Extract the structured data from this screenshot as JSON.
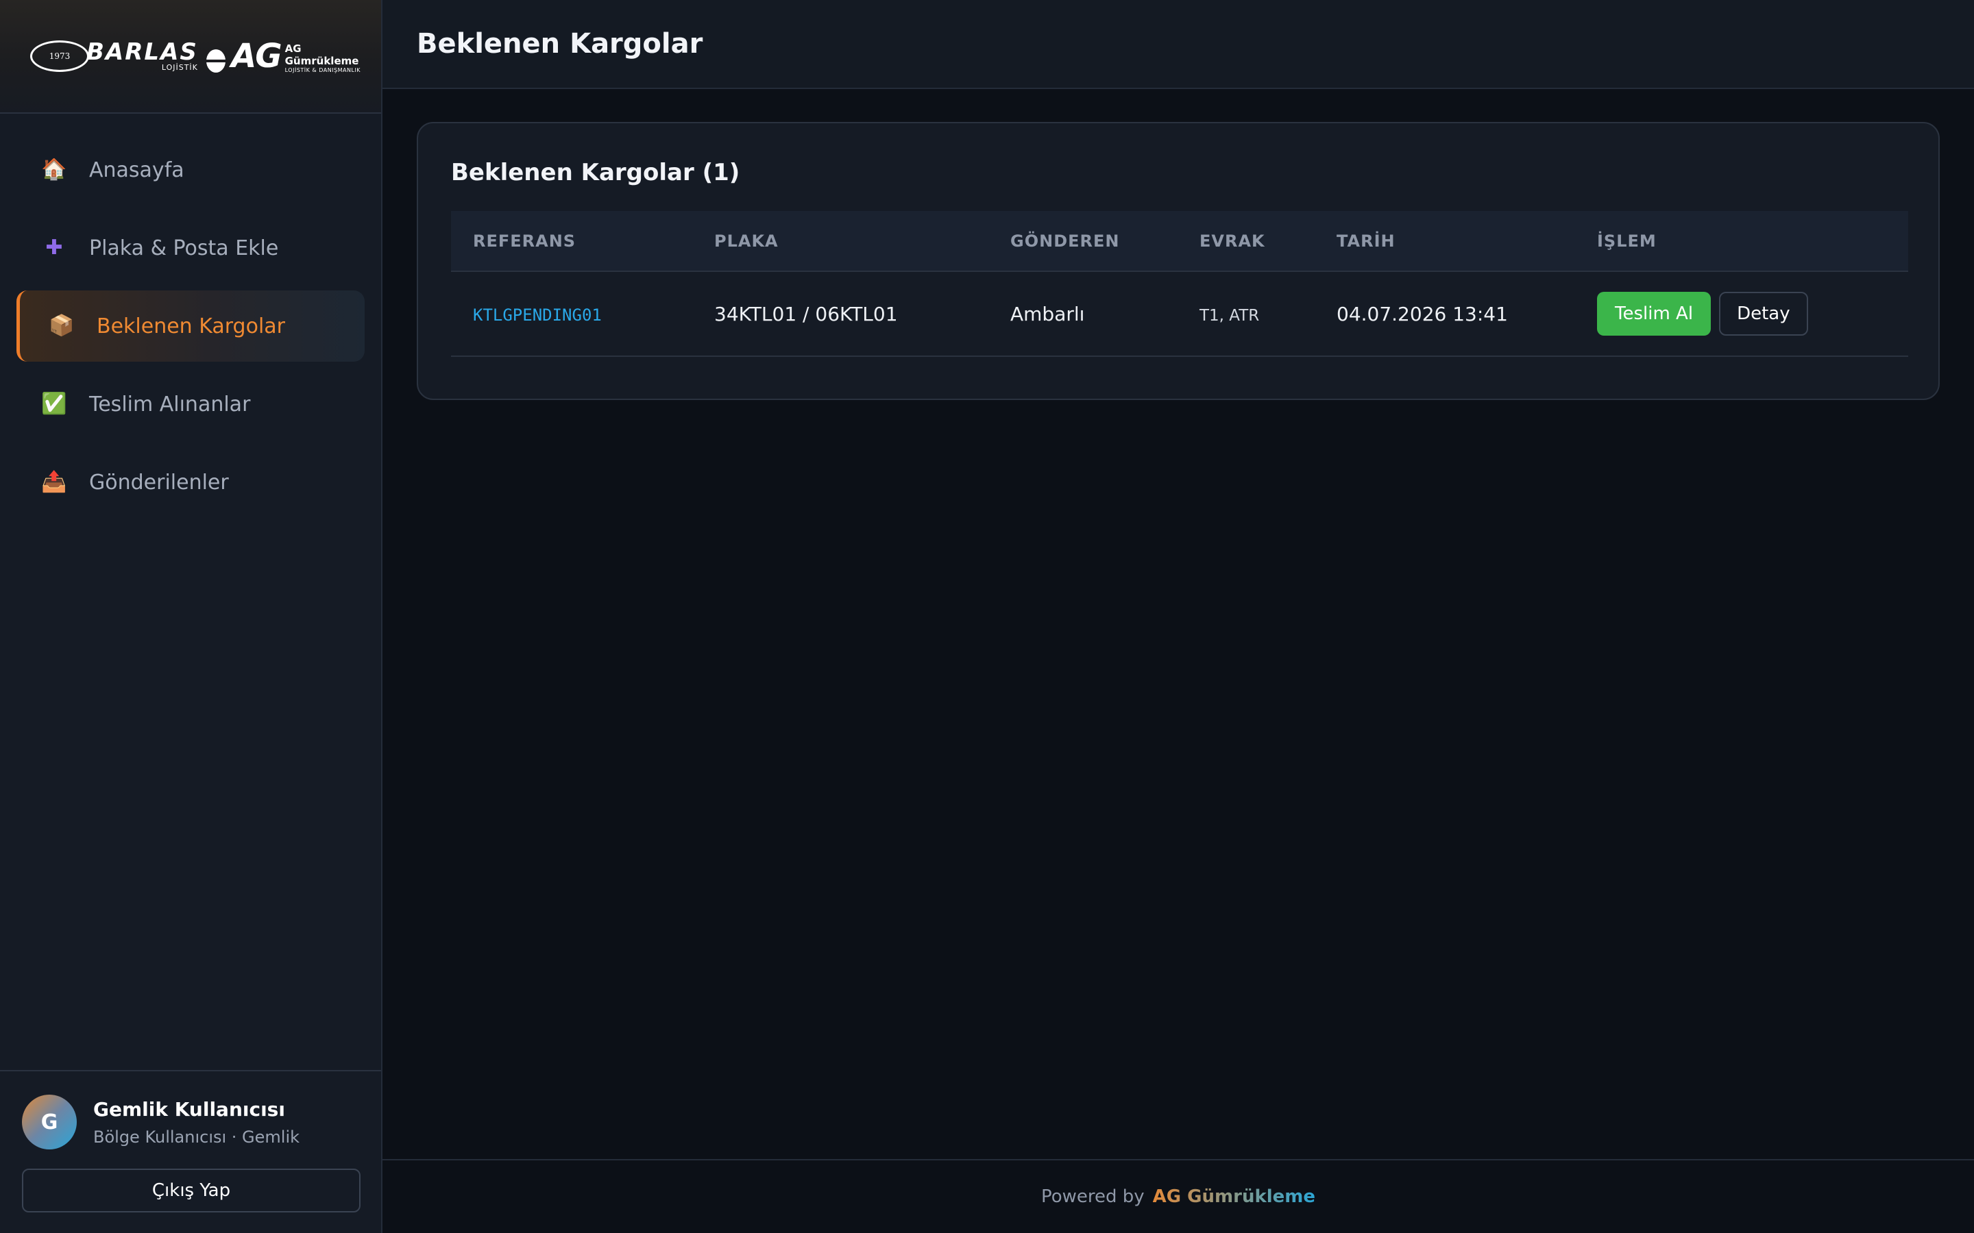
{
  "brand": {
    "logo_year": "1973",
    "logo_name": "BARLAS",
    "logo_sub": "LOJİSTİK",
    "logo_ag": "AG",
    "logo_ag_title": "AG Gümrükleme",
    "logo_ag_sub": "LOJİSTİK & DANIŞMANLIK"
  },
  "sidebar": {
    "items": [
      {
        "label": "Anasayfa",
        "icon": "house-icon",
        "glyph": "🏠",
        "active": false
      },
      {
        "label": "Plaka & Posta Ekle",
        "icon": "plus-icon",
        "glyph": "✚",
        "active": false
      },
      {
        "label": "Beklenen Kargolar",
        "icon": "package-icon",
        "glyph": "📦",
        "active": true
      },
      {
        "label": "Teslim Alınanlar",
        "icon": "check-box-icon",
        "glyph": "✅",
        "active": false
      },
      {
        "label": "Gönderilenler",
        "icon": "outbox-icon",
        "glyph": "📤",
        "active": false
      }
    ]
  },
  "user": {
    "initial": "G",
    "name": "Gemlik Kullanıcısı",
    "role": "Bölge Kullanıcısı · Gemlik",
    "logout_label": "Çıkış Yap"
  },
  "header": {
    "title": "Beklenen Kargolar"
  },
  "card": {
    "title": "Beklenen Kargolar (1)",
    "columns": [
      "REFERANS",
      "PLAKA",
      "GÖNDEREN",
      "EVRAK",
      "TARİH",
      "İŞLEM"
    ],
    "rows": [
      {
        "reference": "KTLGPENDING01",
        "plate": "34KTL01 / 06KTL01",
        "sender": "Ambarlı",
        "documents": "T1, ATR",
        "date": "04.07.2026 13:41",
        "primary_action": "Teslim Al",
        "secondary_action": "Detay"
      }
    ]
  },
  "footer": {
    "prefix": "Powered by",
    "brand": "AG Gümrükleme"
  },
  "colors": {
    "accent": "#ee7d2a",
    "success": "#3bb54a",
    "link": "#2aa8e8",
    "background": "#0c1017",
    "sidebar": "#151b25"
  }
}
